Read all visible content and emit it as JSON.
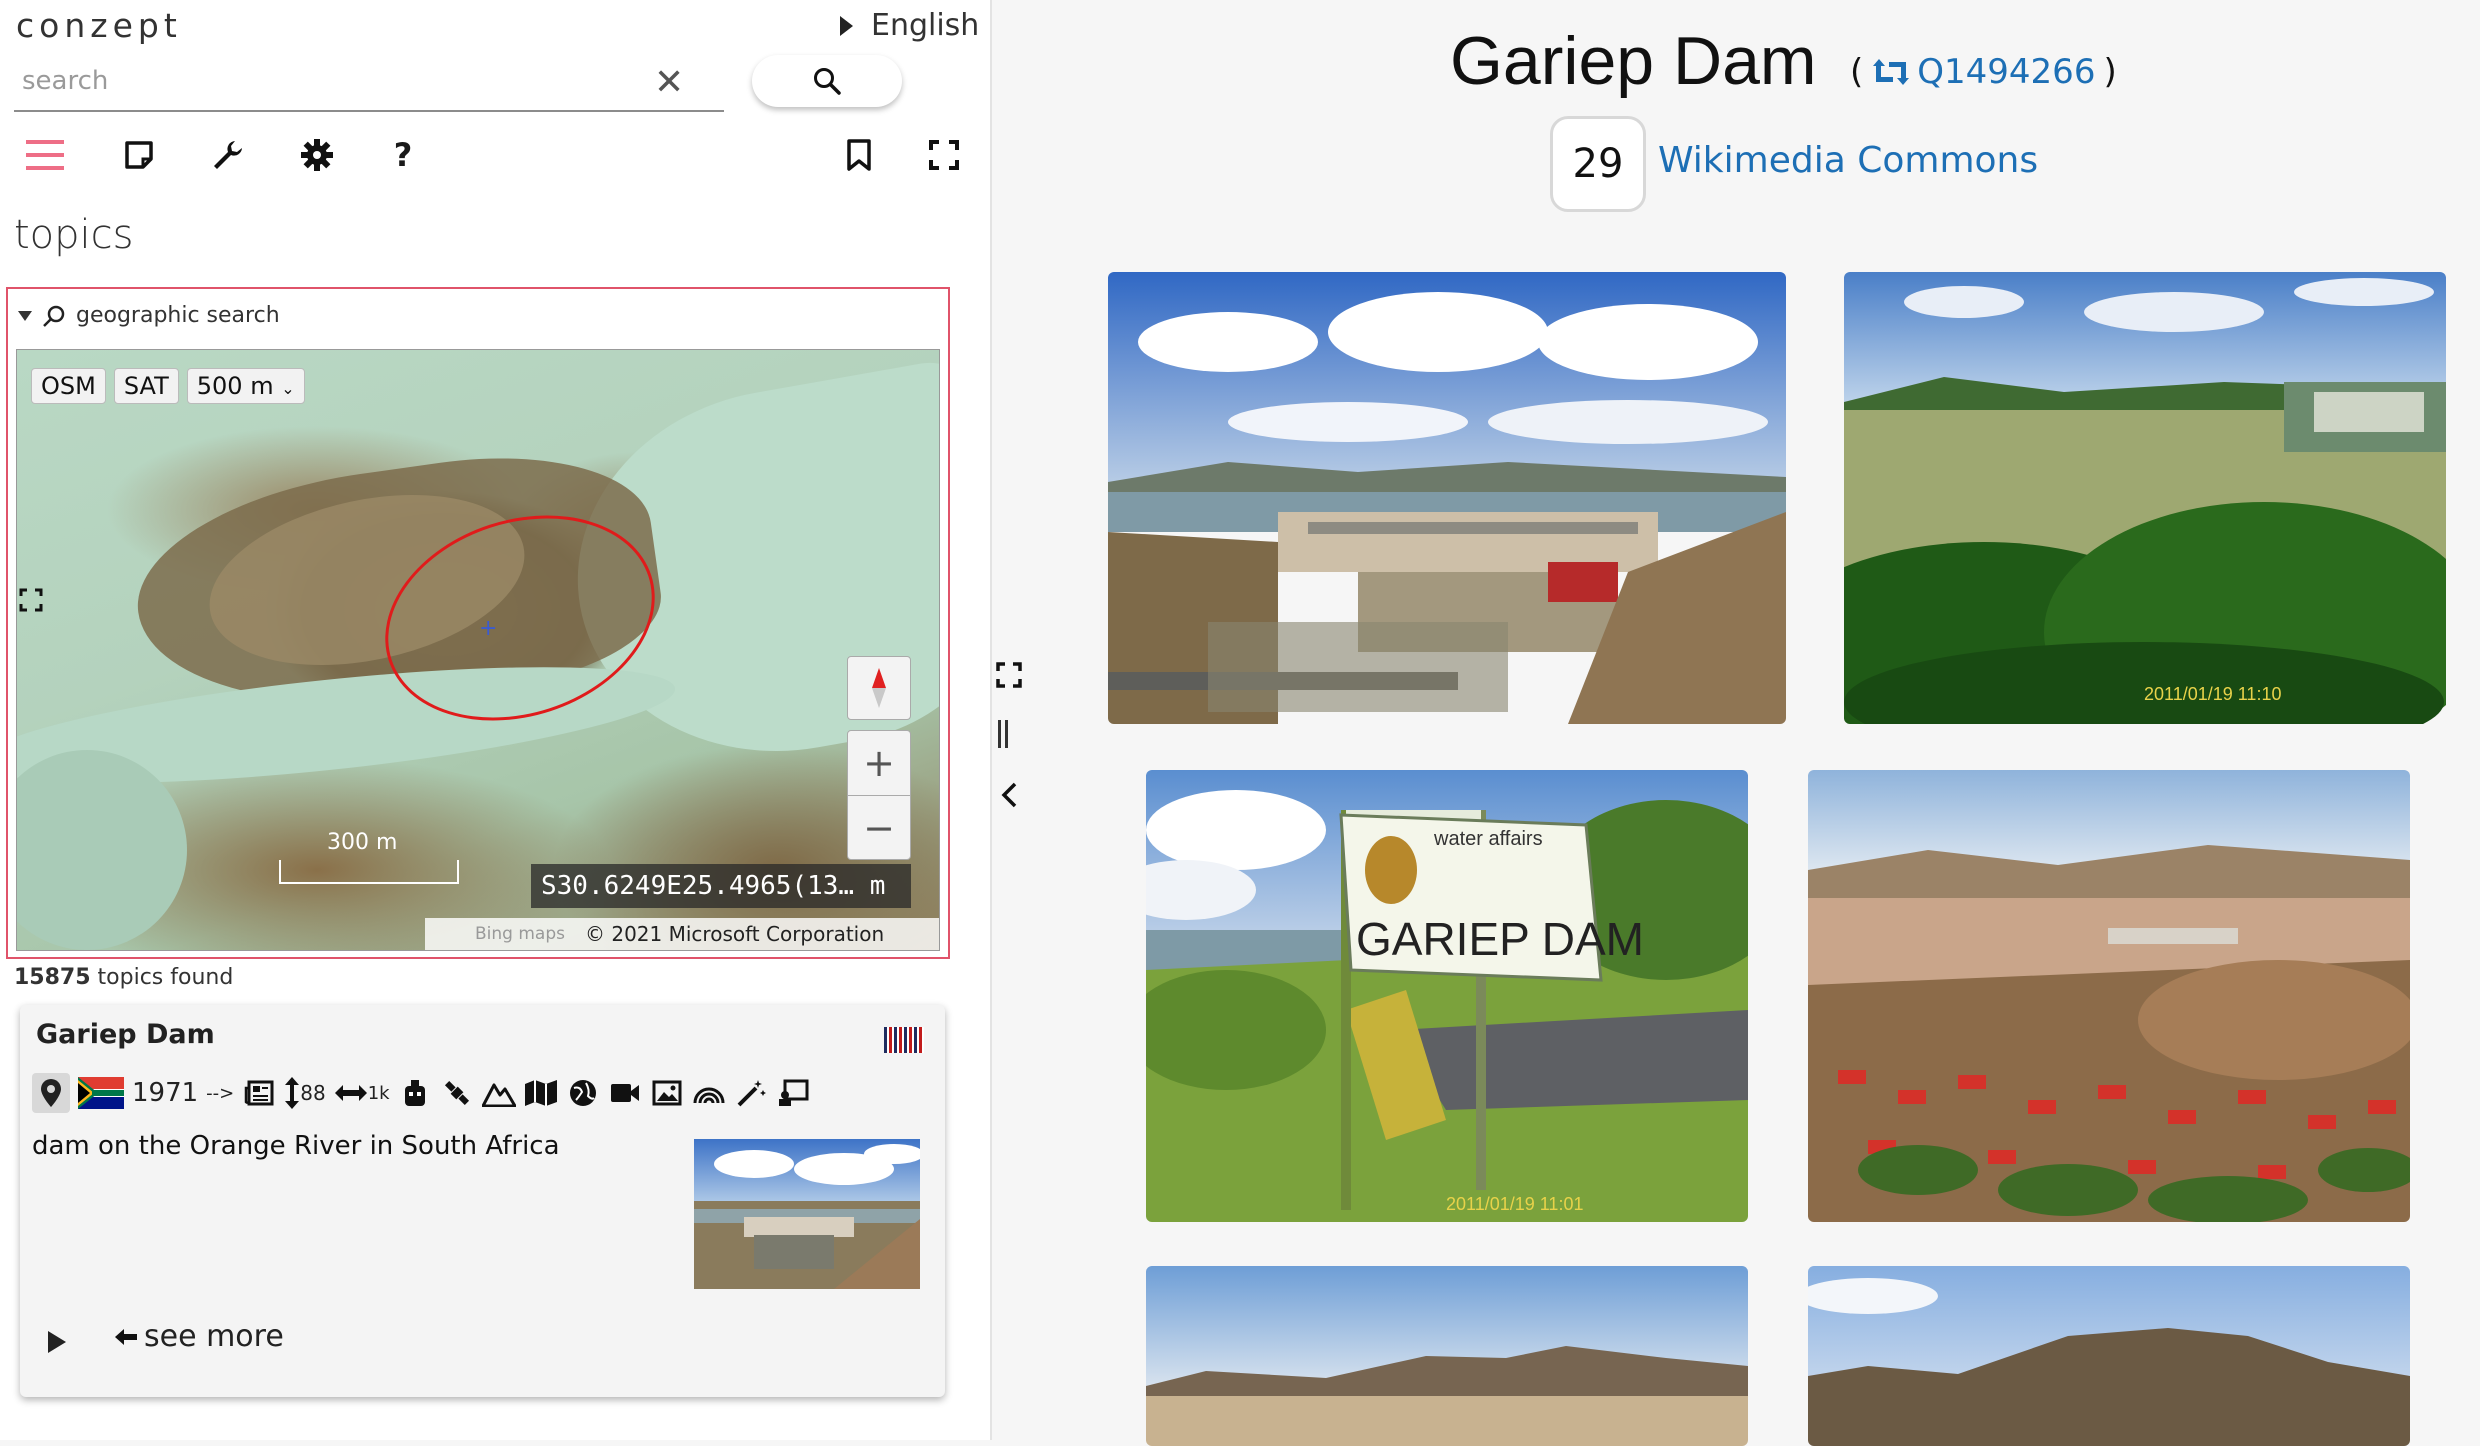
{
  "app": {
    "name": "conzept",
    "language": "English"
  },
  "search": {
    "placeholder": "search",
    "value": ""
  },
  "toolbar": {
    "icons": [
      "menu-icon",
      "sticky-note-icon",
      "wrench-icon",
      "gear-icon",
      "help-icon",
      "bookmark-icon",
      "fullscreen-icon"
    ],
    "help_label": "?"
  },
  "topics": {
    "heading": "topics"
  },
  "geo_search": {
    "label": "geographic search",
    "layers": [
      "OSM",
      "SAT"
    ],
    "radius": "500 m",
    "scale_label": "300 m",
    "coords": "S30.6249̸E25.4965̸ 13… m",
    "coords_display": "S30.6249E25.4965(13… m",
    "attribution": "© 2021 Microsoft Corporation",
    "attribution_logo": "Bing maps"
  },
  "results": {
    "count": "15875",
    "suffix": " topics found"
  },
  "card": {
    "title": "Gariep Dam",
    "year": "1971",
    "arrow": "-->",
    "height": "88",
    "length": "1k",
    "description": "dam on the Orange River in South Africa",
    "see_more": "see more"
  },
  "article": {
    "title": "Gariep Dam",
    "paren_open": "(",
    "paren_close": ")",
    "qid": "Q1494266",
    "image_count": "29",
    "source_link": "Wikimedia Commons"
  },
  "photos": [
    {
      "name": "dam-overview",
      "timestamp": ""
    },
    {
      "name": "reservoir-lake",
      "timestamp": "2011/01/19  11:10"
    },
    {
      "name": "gariep-dam-sign",
      "timestamp": "2011/01/19  11:01",
      "sign_text": "GARIEP DAM",
      "sign_small": "water affairs"
    },
    {
      "name": "resort-view",
      "timestamp": ""
    },
    {
      "name": "landscape-1",
      "timestamp": ""
    },
    {
      "name": "landscape-2",
      "timestamp": ""
    }
  ],
  "colors": {
    "accent": "#e0536a",
    "link": "#1d6fb5",
    "ring": "#e01b1b"
  }
}
